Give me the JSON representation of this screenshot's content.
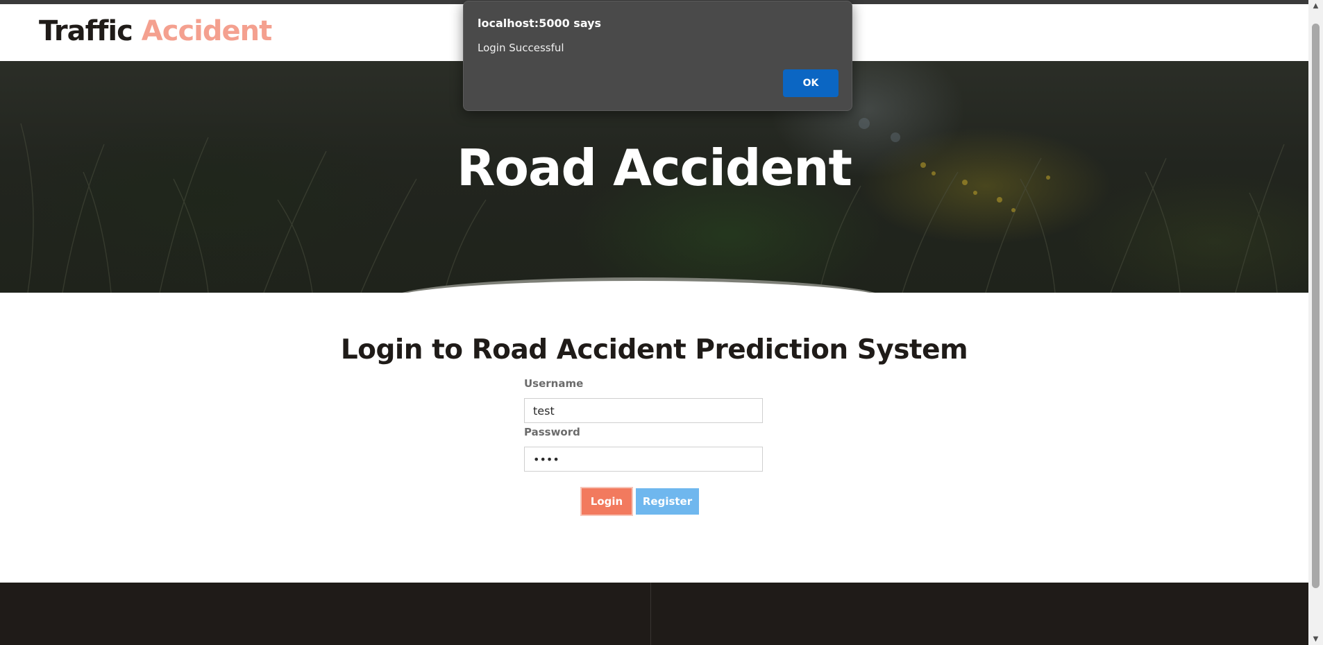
{
  "header": {
    "brand_part1": "Traffic",
    "brand_part2": "Accident"
  },
  "hero": {
    "title": "Road Accident"
  },
  "login": {
    "title": "Login to Road Accident Prediction System",
    "username_label": "Username",
    "username_value": "test",
    "password_label": "Password",
    "password_value": "test",
    "login_button": "Login",
    "register_button": "Register"
  },
  "dialog": {
    "title": "localhost:5000 says",
    "message": "Login Successful",
    "ok_button": "OK"
  },
  "colors": {
    "brand_dark": "#1f1b18",
    "brand_accent": "#f4a08f",
    "login_button": "#f27a5e",
    "register_button": "#6fb7ee",
    "dialog_ok": "#0b66c3",
    "footer": "#1f1b18"
  }
}
